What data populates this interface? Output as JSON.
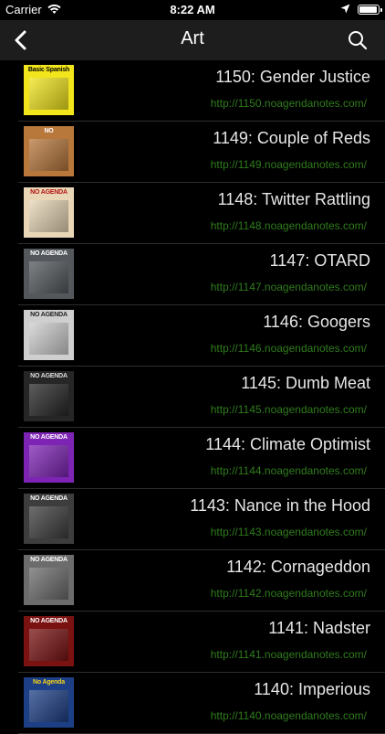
{
  "status": {
    "carrier": "Carrier",
    "time": "8:22 AM"
  },
  "nav": {
    "title": "Art"
  },
  "episodes": [
    {
      "title": "1150: Gender Justice",
      "url": "http://1150.noagendanotes.com/",
      "thumb_text": "Basic Spanish",
      "thumb_bg": "#f2e51b",
      "thumb_fg": "#000"
    },
    {
      "title": "1149: Couple of Reds",
      "url": "http://1149.noagendanotes.com/",
      "thumb_text": "NO",
      "thumb_bg": "#b8773b",
      "thumb_fg": "#fff"
    },
    {
      "title": "1148: Twitter Rattling",
      "url": "http://1148.noagendanotes.com/",
      "thumb_text": "NO AGENDA",
      "thumb_bg": "#e8d6b6",
      "thumb_fg": "#b31414"
    },
    {
      "title": "1147: OTARD",
      "url": "http://1147.noagendanotes.com/",
      "thumb_text": "NO AGENDA",
      "thumb_bg": "#54585c",
      "thumb_fg": "#fff"
    },
    {
      "title": "1146: Googers",
      "url": "http://1146.noagendanotes.com/",
      "thumb_text": "NO AGENDA",
      "thumb_bg": "#cfcfcf",
      "thumb_fg": "#222"
    },
    {
      "title": "1145: Dumb Meat",
      "url": "http://1145.noagendanotes.com/",
      "thumb_text": "NO AGENDA",
      "thumb_bg": "#262626",
      "thumb_fg": "#ddd"
    },
    {
      "title": "1144: Climate Optimist",
      "url": "http://1144.noagendanotes.com/",
      "thumb_text": "NO AGENDA",
      "thumb_bg": "#7e24b5",
      "thumb_fg": "#fff"
    },
    {
      "title": "1143: Nance in the Hood",
      "url": "http://1143.noagendanotes.com/",
      "thumb_text": "NO AGENDA",
      "thumb_bg": "#3d3d3d",
      "thumb_fg": "#fff"
    },
    {
      "title": "1142: Cornageddon",
      "url": "http://1142.noagendanotes.com/",
      "thumb_text": "NO AGENDA",
      "thumb_bg": "#6c6c6c",
      "thumb_fg": "#fff"
    },
    {
      "title": "1141: Nadster",
      "url": "http://1141.noagendanotes.com/",
      "thumb_text": "NO AGENDA",
      "thumb_bg": "#7a1212",
      "thumb_fg": "#fff"
    },
    {
      "title": "1140: Imperious",
      "url": "http://1140.noagendanotes.com/",
      "thumb_text": "No Agenda",
      "thumb_bg": "#1d3f86",
      "thumb_fg": "#f5d31a"
    }
  ]
}
